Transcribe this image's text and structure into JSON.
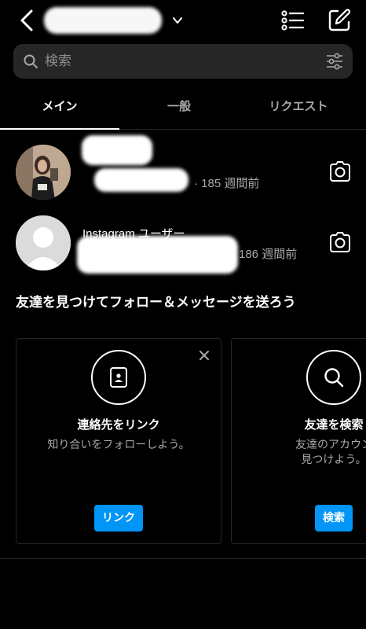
{
  "header": {
    "account_name": "",
    "back_icon": "chevron-left-icon",
    "dropdown_icon": "chevron-down-icon",
    "list_icon": "list-icon",
    "compose_icon": "compose-icon"
  },
  "search": {
    "placeholder": "検索",
    "search_icon": "search-icon",
    "filter_icon": "filter-icon"
  },
  "tabs": [
    {
      "label": "メイン",
      "active": true
    },
    {
      "label": "一般",
      "active": false
    },
    {
      "label": "リクエスト",
      "active": false
    }
  ],
  "threads": [
    {
      "name": "",
      "meta": "· 185 週間前",
      "camera_icon": "camera-icon"
    },
    {
      "name": "Instagram ユーザー",
      "meta": "186 週間前",
      "camera_icon": "camera-icon"
    }
  ],
  "suggestions": {
    "title": "友達を見つけてフォロー＆メッセージを送ろう",
    "cards": [
      {
        "icon": "contact-card-icon",
        "title": "連絡先をリンク",
        "subtitle": "知り合いをフォローしよう。",
        "button": "リンク",
        "close_icon": "close-icon"
      },
      {
        "icon": "search-icon",
        "title": "友達を検索",
        "subtitle_line1": "友達のアカウン",
        "subtitle_line2": "見つけよう。",
        "button": "検索"
      }
    ]
  },
  "colors": {
    "background": "#000000",
    "accent": "#0095f6",
    "secondary_text": "#a8a8a8",
    "search_bg": "#262626"
  }
}
